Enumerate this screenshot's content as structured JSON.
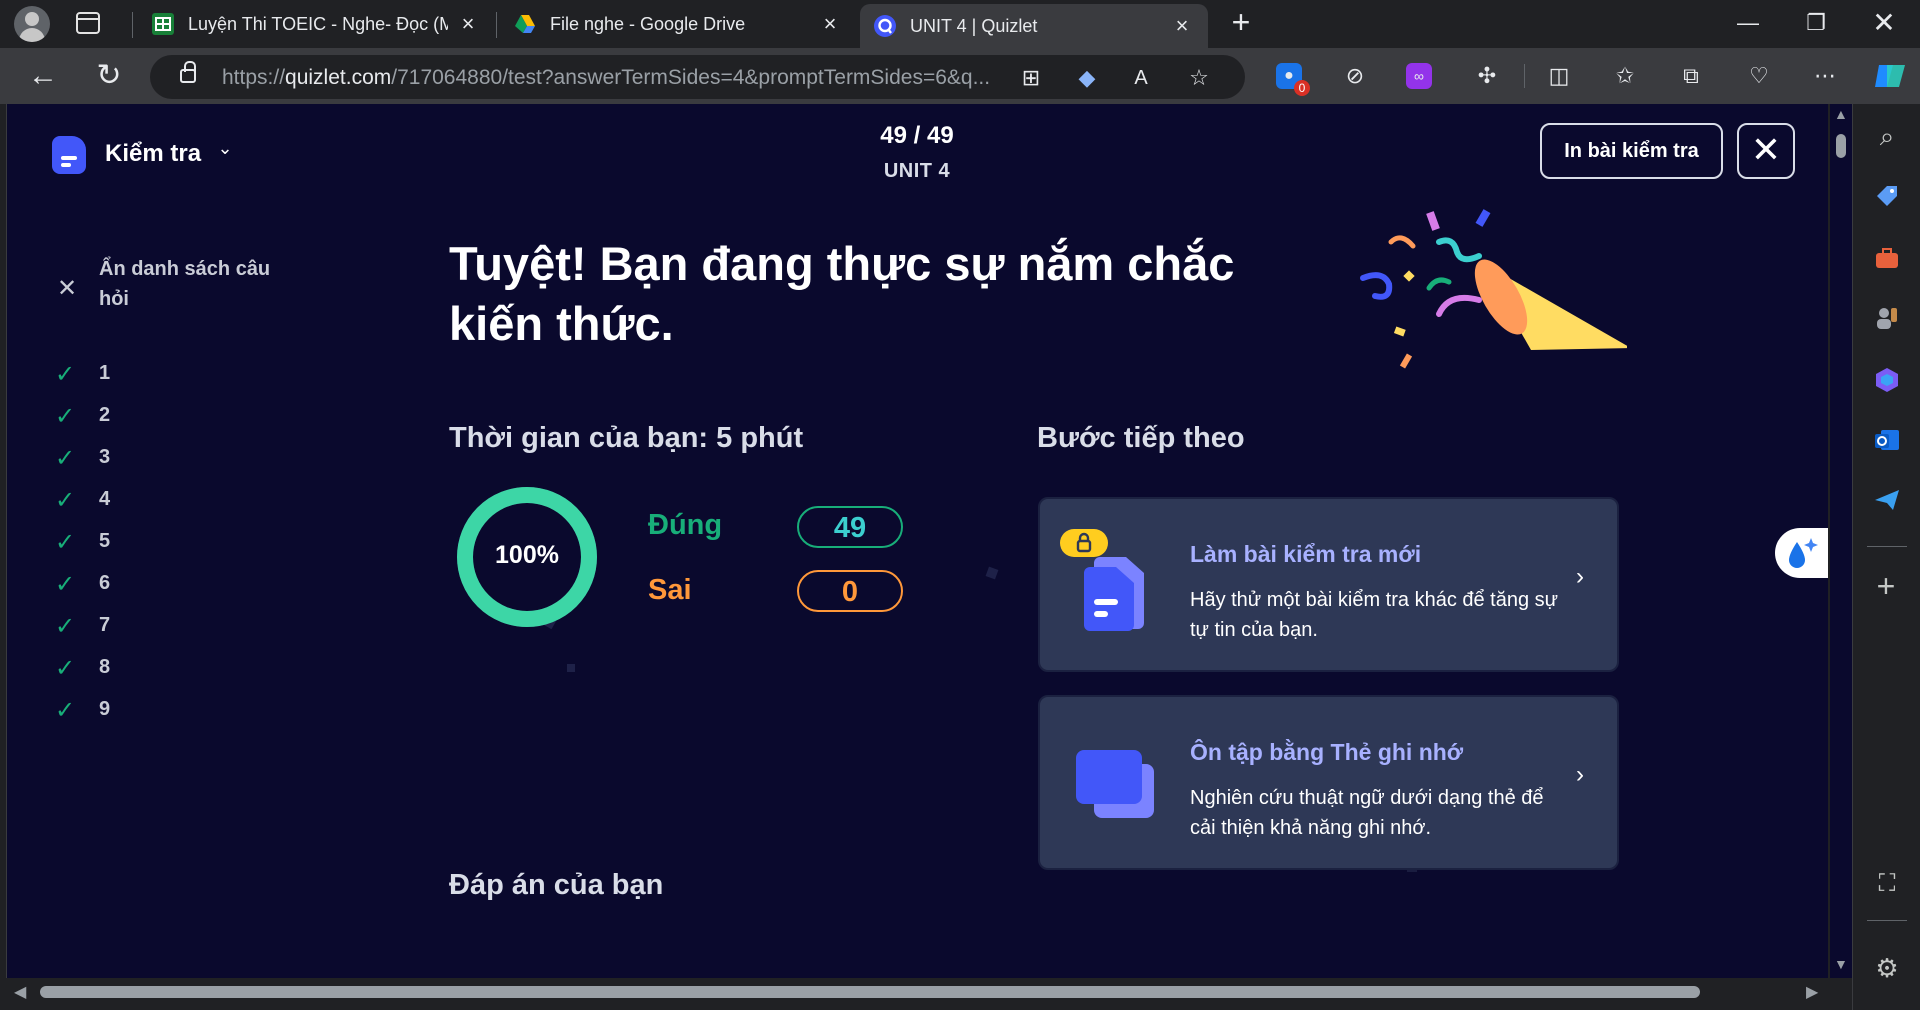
{
  "browser": {
    "tabs": [
      {
        "title": "Luyện Thi TOEIC - Nghe- Đọc (M",
        "active": false,
        "favicon": "google-sheets-icon"
      },
      {
        "title": "File nghe - Google Drive",
        "active": false,
        "favicon": "google-drive-icon"
      },
      {
        "title": "UNIT 4 | Quizlet",
        "active": true,
        "favicon": "quizlet-icon"
      }
    ],
    "url_prefix": "https://",
    "url_host": "quizlet.com",
    "url_path": "/717064880/test?answerTermSides=4&promptTermSides=6&q...",
    "extension_badge": "0"
  },
  "quiz": {
    "mode_label": "Kiểm tra",
    "progress": "49 / 49",
    "set_title": "UNIT 4",
    "print_button": "In bài kiểm tra",
    "hide_list_label": "Ẩn danh sách câu hỏi",
    "questions": [
      "1",
      "2",
      "3",
      "4",
      "5",
      "6",
      "7",
      "8",
      "9"
    ],
    "headline": "Tuyệt! Bạn đang thực sự nắm chắc kiến thức.",
    "time_label": "Thời gian của bạn: 5 phút",
    "score_percent": "100%",
    "score_fraction": 1.0,
    "correct_label": "Đúng",
    "correct_count": "49",
    "wrong_label": "Sai",
    "wrong_count": "0",
    "next_steps_label": "Bước tiếp theo",
    "cards": [
      {
        "title": "Làm bài kiểm tra mới",
        "desc": "Hãy thử một bài kiểm tra khác để tăng sự tự tin của bạn."
      },
      {
        "title": "Ôn tập bằng Thẻ ghi nhớ",
        "desc": "Nghiên cứu thuật ngữ dưới dạng thẻ để cải thiện khả năng ghi nhớ."
      }
    ],
    "answers_label": "Đáp án của bạn"
  },
  "colors": {
    "page_bg": "#0a092d",
    "accent_green": "#18ae79",
    "accent_orange": "#ff983a",
    "card_bg": "#2e3856",
    "link_purple": "#a8b1ff",
    "brand_blue": "#4257f9"
  }
}
